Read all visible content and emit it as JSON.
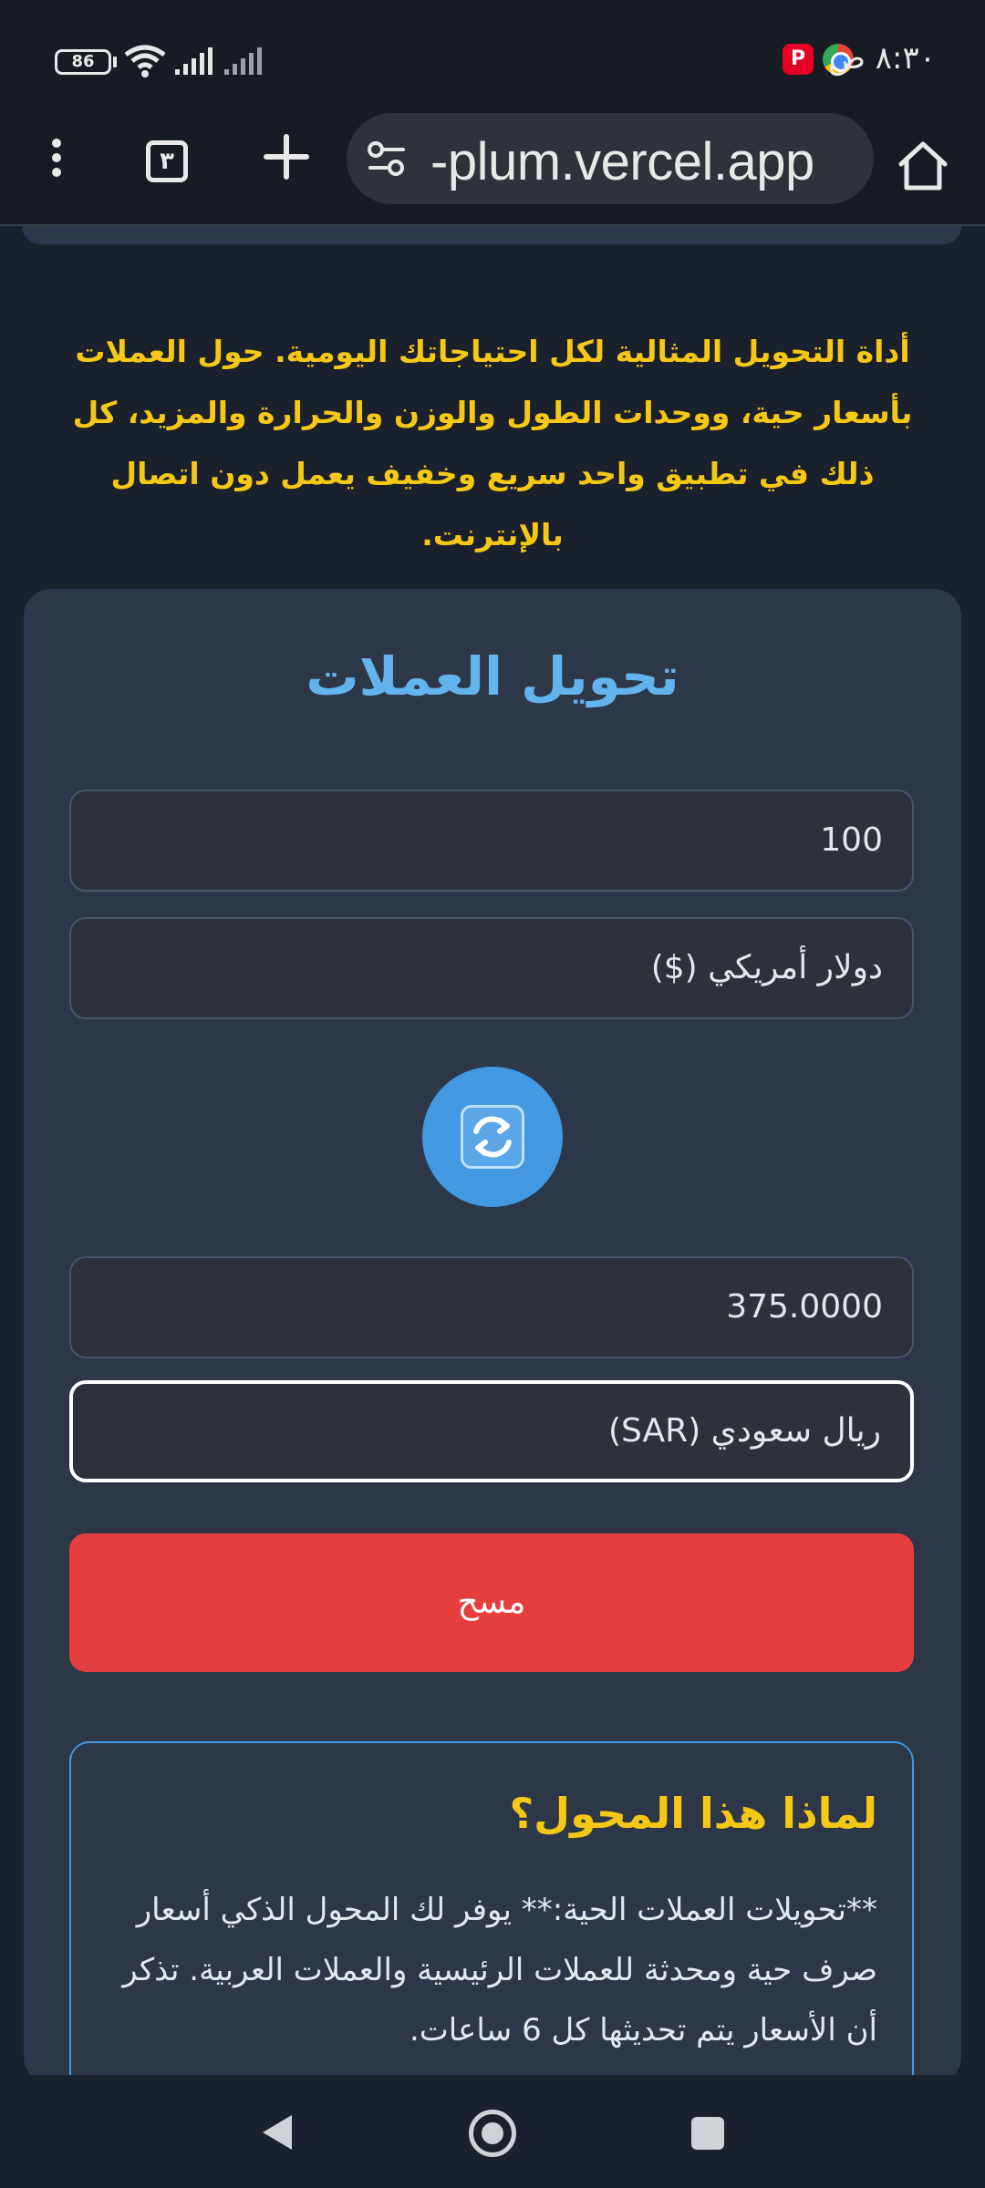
{
  "status_bar": {
    "time": "٨:٣٠ ص",
    "battery": "86",
    "apps": [
      "pinterest-icon",
      "chrome-icon"
    ],
    "indicators": [
      "wifi-icon",
      "signal-icon",
      "signal-icon"
    ]
  },
  "browser": {
    "url": "-plum.vercel.app",
    "tab_count": "٣",
    "icons": [
      "home-icon",
      "tune-icon",
      "plus-icon",
      "tabs-icon",
      "more-vert-icon"
    ]
  },
  "intro_text": "أداة التحويل المثالية لكل احتياجاتك اليومية. حول العملات بأسعار حية، ووحدات الطول والوزن والحرارة والمزيد، كل ذلك في تطبيق واحد سريع وخفيف يعمل دون اتصال بالإنترنت.",
  "converter": {
    "title": "تحويل العملات",
    "from_amount": "100",
    "from_currency": "دولار أمريكي ($)",
    "swap_icon": "swap-arrows-icon",
    "to_amount": "375.0000",
    "to_currency": "ريال سعودي (SAR)",
    "clear_label": "مسح"
  },
  "why": {
    "title": "لماذا هذا المحول؟",
    "text": "**تحويلات العملات الحية:** يوفر لك المحول الذكي أسعار صرف حية ومحدثة للعملات الرئيسية والعملات العربية. تذكر أن الأسعار يتم تحديثها كل 6 ساعات."
  },
  "nav": {
    "icons": [
      "back-icon",
      "home-icon",
      "recents-icon"
    ]
  },
  "colors": {
    "background": "#1a202c",
    "card": "#2d3748",
    "accent_blue": "#4299e1",
    "title_blue": "#63b3ed",
    "gold": "#f6c816",
    "danger": "#e53e3e"
  }
}
